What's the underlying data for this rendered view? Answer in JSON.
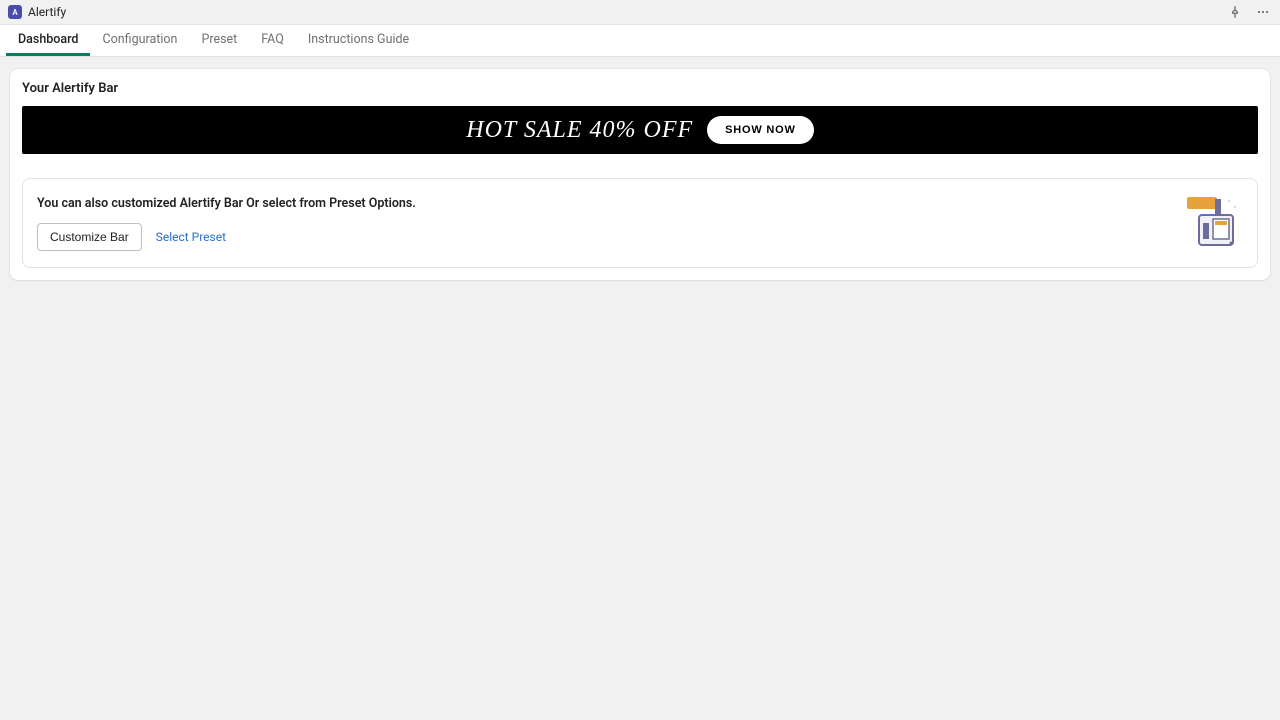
{
  "header": {
    "app_name": "Alertify",
    "app_icon_letter": "A"
  },
  "tabs": [
    {
      "label": "Dashboard",
      "active": true
    },
    {
      "label": "Configuration",
      "active": false
    },
    {
      "label": "Preset",
      "active": false
    },
    {
      "label": "FAQ",
      "active": false
    },
    {
      "label": "Instructions Guide",
      "active": false
    }
  ],
  "main": {
    "card_title": "Your Alertify Bar",
    "alert_bar": {
      "message": "HOT SALE 40% OFF",
      "button_label": "SHOW NOW"
    },
    "customize_panel": {
      "text": "You can also customized Alertify Bar Or select from Preset Options.",
      "customize_btn": "Customize Bar",
      "preset_link": "Select Preset"
    }
  }
}
